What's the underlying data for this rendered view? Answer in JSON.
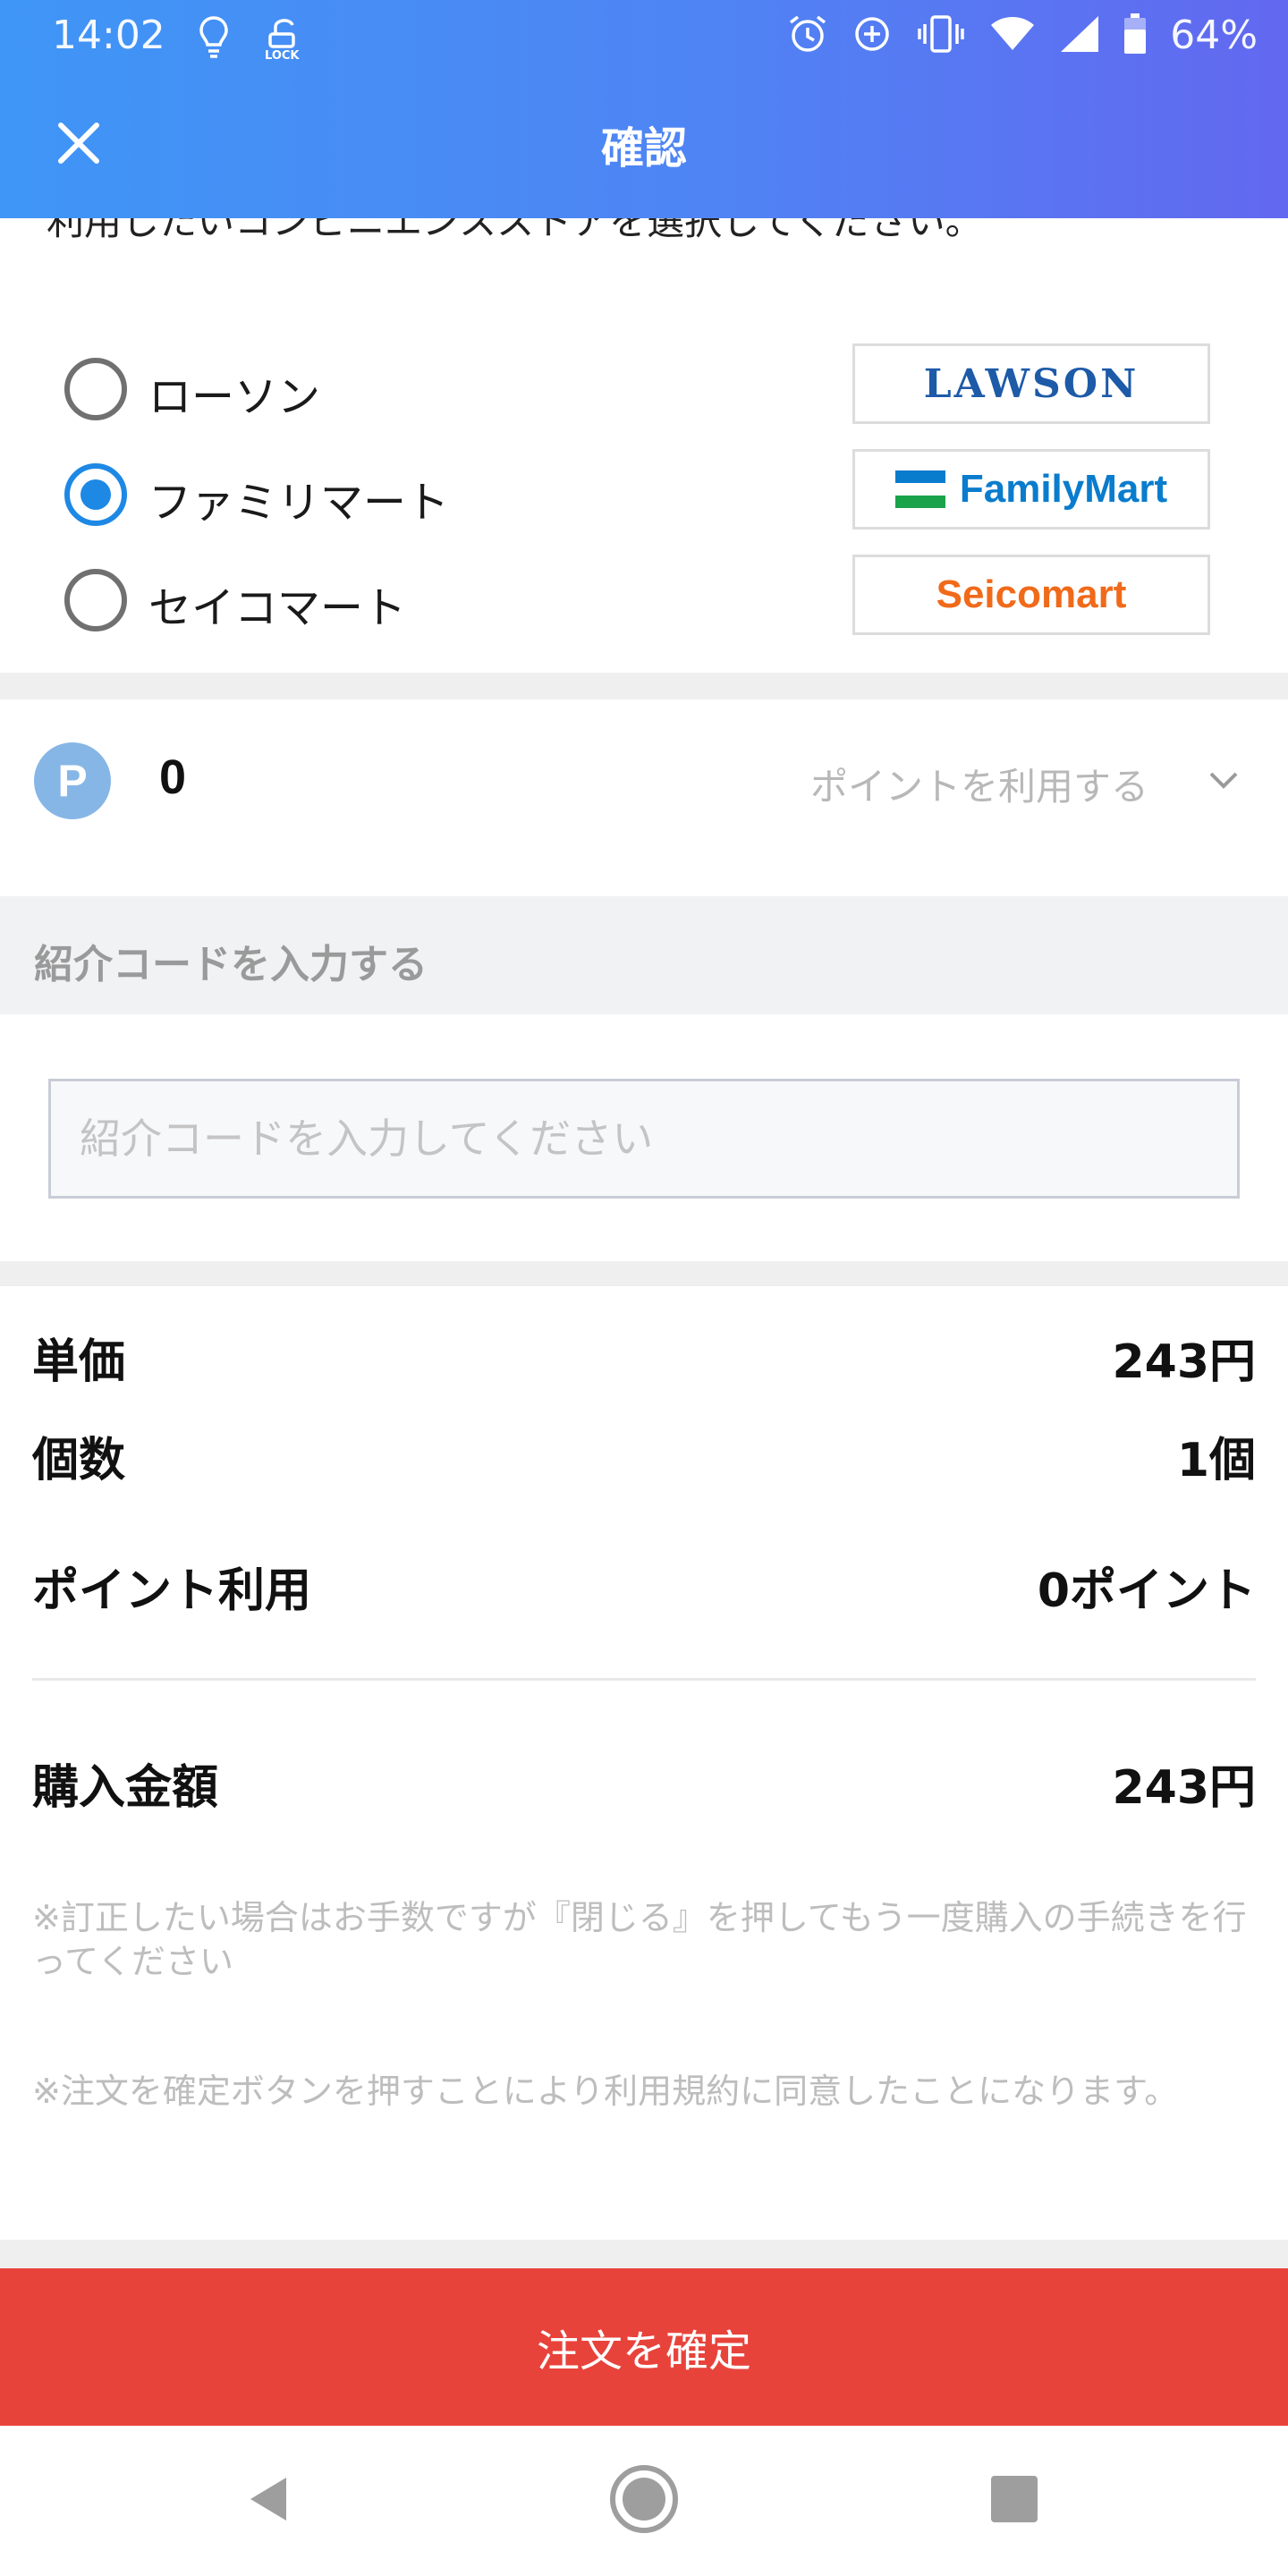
{
  "status_bar": {
    "time": "14:02",
    "battery": "64%",
    "left_icons": [
      "lightbulb-icon",
      "lock-icon"
    ],
    "right_icons": [
      "alarm-icon",
      "data-saver-icon",
      "vibrate-icon",
      "wifi-icon",
      "signal-icon",
      "battery-icon"
    ]
  },
  "header": {
    "title": "確認",
    "close_icon": "close-icon"
  },
  "store_section": {
    "cut_text": "利用したいコンビニエンスストアを選択してください。",
    "options": [
      {
        "label": "ローソン",
        "logo_text": "LAWSON",
        "selected": false
      },
      {
        "label": "ファミリマート",
        "logo_text": "FamilyMart",
        "selected": true
      },
      {
        "label": "セイコマート",
        "logo_text": "Seicomart",
        "selected": false
      }
    ]
  },
  "points": {
    "icon_letter": "P",
    "value": "0",
    "use_label": "ポイントを利用する"
  },
  "referral": {
    "heading": "紹介コードを入力する",
    "placeholder": "紹介コードを入力してください",
    "value": ""
  },
  "summary": {
    "unit_price_label": "単価",
    "unit_price_value": "243円",
    "quantity_label": "個数",
    "quantity_value": "1個",
    "points_label": "ポイント利用",
    "points_value": "0ポイント",
    "total_label": "購入金額",
    "total_value": "243円"
  },
  "notes": {
    "note1": "※訂正したい場合はお手数ですが『閉じる』を押してもう一度購入の手続きを行ってください",
    "note2": "※注文を確定ボタンを押すことにより利用規約に同意したことになります。"
  },
  "confirm_button": "注文を確定",
  "colors": {
    "header_gradient_start": "#3f96f6",
    "header_gradient_end": "#6268f0",
    "radio_selected": "#1e88e5",
    "confirm_button": "#e8433b",
    "points_icon": "#86b6e6"
  },
  "nav": [
    "back-icon",
    "home-icon",
    "recents-icon"
  ]
}
